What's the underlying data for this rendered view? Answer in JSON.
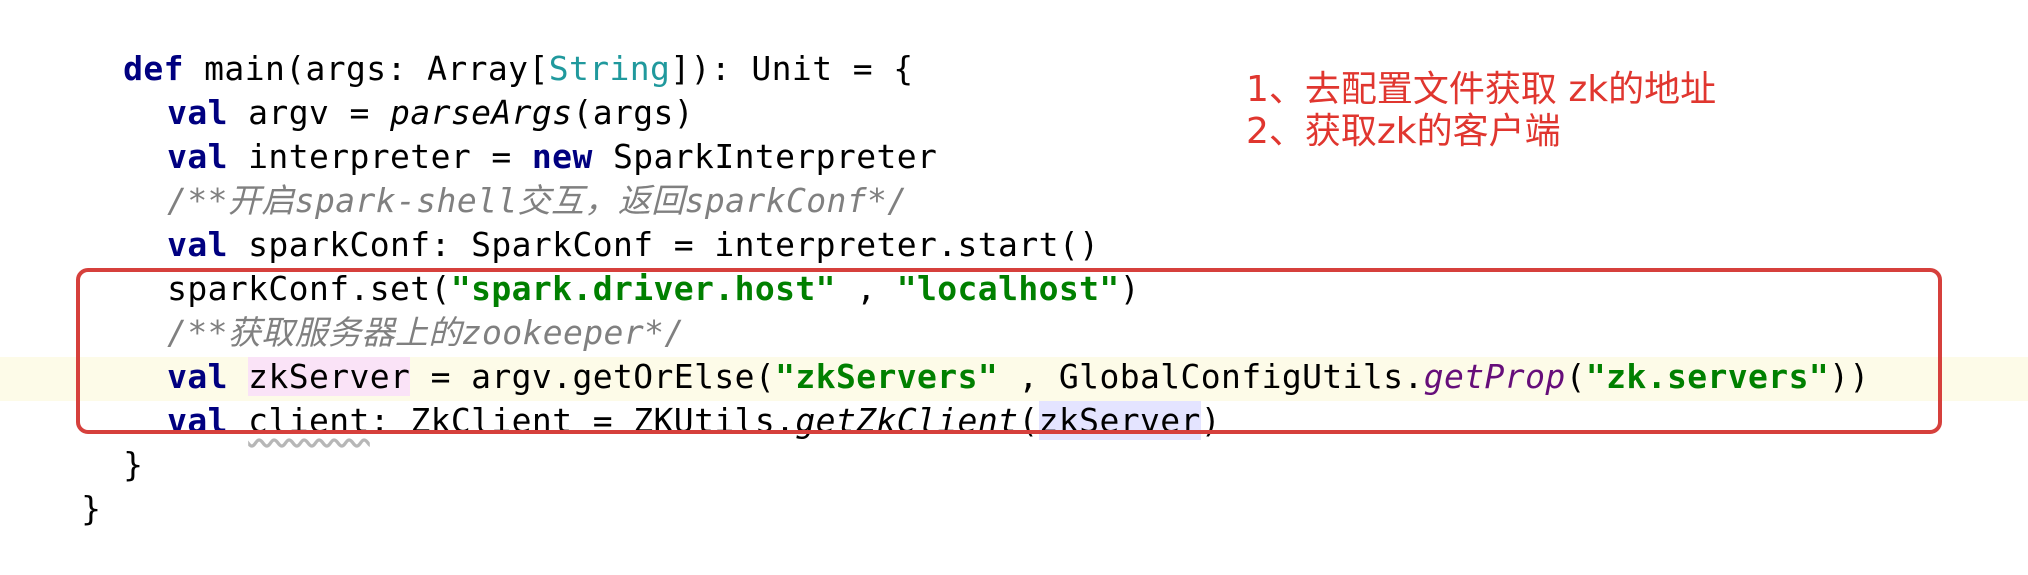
{
  "editor": {
    "line_1": {
      "kw_def": "def",
      "sig_start": " main(args: Array[",
      "type_param": "String",
      "sig_end": "]): Unit = {"
    },
    "line_2": {
      "kw_val": "val",
      "pre": " argv = ",
      "call": "parseArgs",
      "post": "(args)"
    },
    "line_3": {
      "kw_val": "val",
      "mid": " interpreter = ",
      "kw_new": "new",
      "post": " SparkInterpreter"
    },
    "line_4": {
      "comment": "/**开启spark-shell交互，返回sparkConf*/"
    },
    "line_5": {
      "kw_val": "val",
      "post": " sparkConf: SparkConf = interpreter.start()"
    },
    "line_6": {
      "pre": "sparkConf.set(",
      "str_1": "\"spark.driver.host\"",
      "sep": " , ",
      "str_2": "\"localhost\"",
      "post": ")"
    },
    "line_7": {
      "comment": "/**获取服务器上的zookeeper*/"
    },
    "line_8": {
      "kw_val": "val",
      "space": " ",
      "ident": "zkServer",
      "mid": " = argv.getOrElse(",
      "str_1": "\"zkServers\"",
      "sep": " , GlobalConfigUtils.",
      "call": "getProp",
      "paren": "(",
      "str_2": "\"zk.servers\"",
      "post": "))"
    },
    "line_9": {
      "kw_val": "val",
      "space": " ",
      "ident": "client",
      "mid": ": ZkClient = ZKUtils.",
      "call": "getZkClient",
      "paren": "(",
      "arg": "zkServer",
      "post": ")"
    },
    "line_10": {
      "text": "}"
    },
    "line_11": {
      "text": "}"
    }
  },
  "annotations": {
    "note_1": "1、去配置文件获取 zk的地址",
    "note_2": "2、获取zk的客户端"
  },
  "colors": {
    "keyword": "#000080",
    "string": "#008000",
    "comment": "#808080",
    "type_param": "#20999d",
    "static_call": "#660e7a",
    "annotation": "#e0362f",
    "highlight_box": "#d6403c",
    "current_line": "#fdfbe8"
  }
}
